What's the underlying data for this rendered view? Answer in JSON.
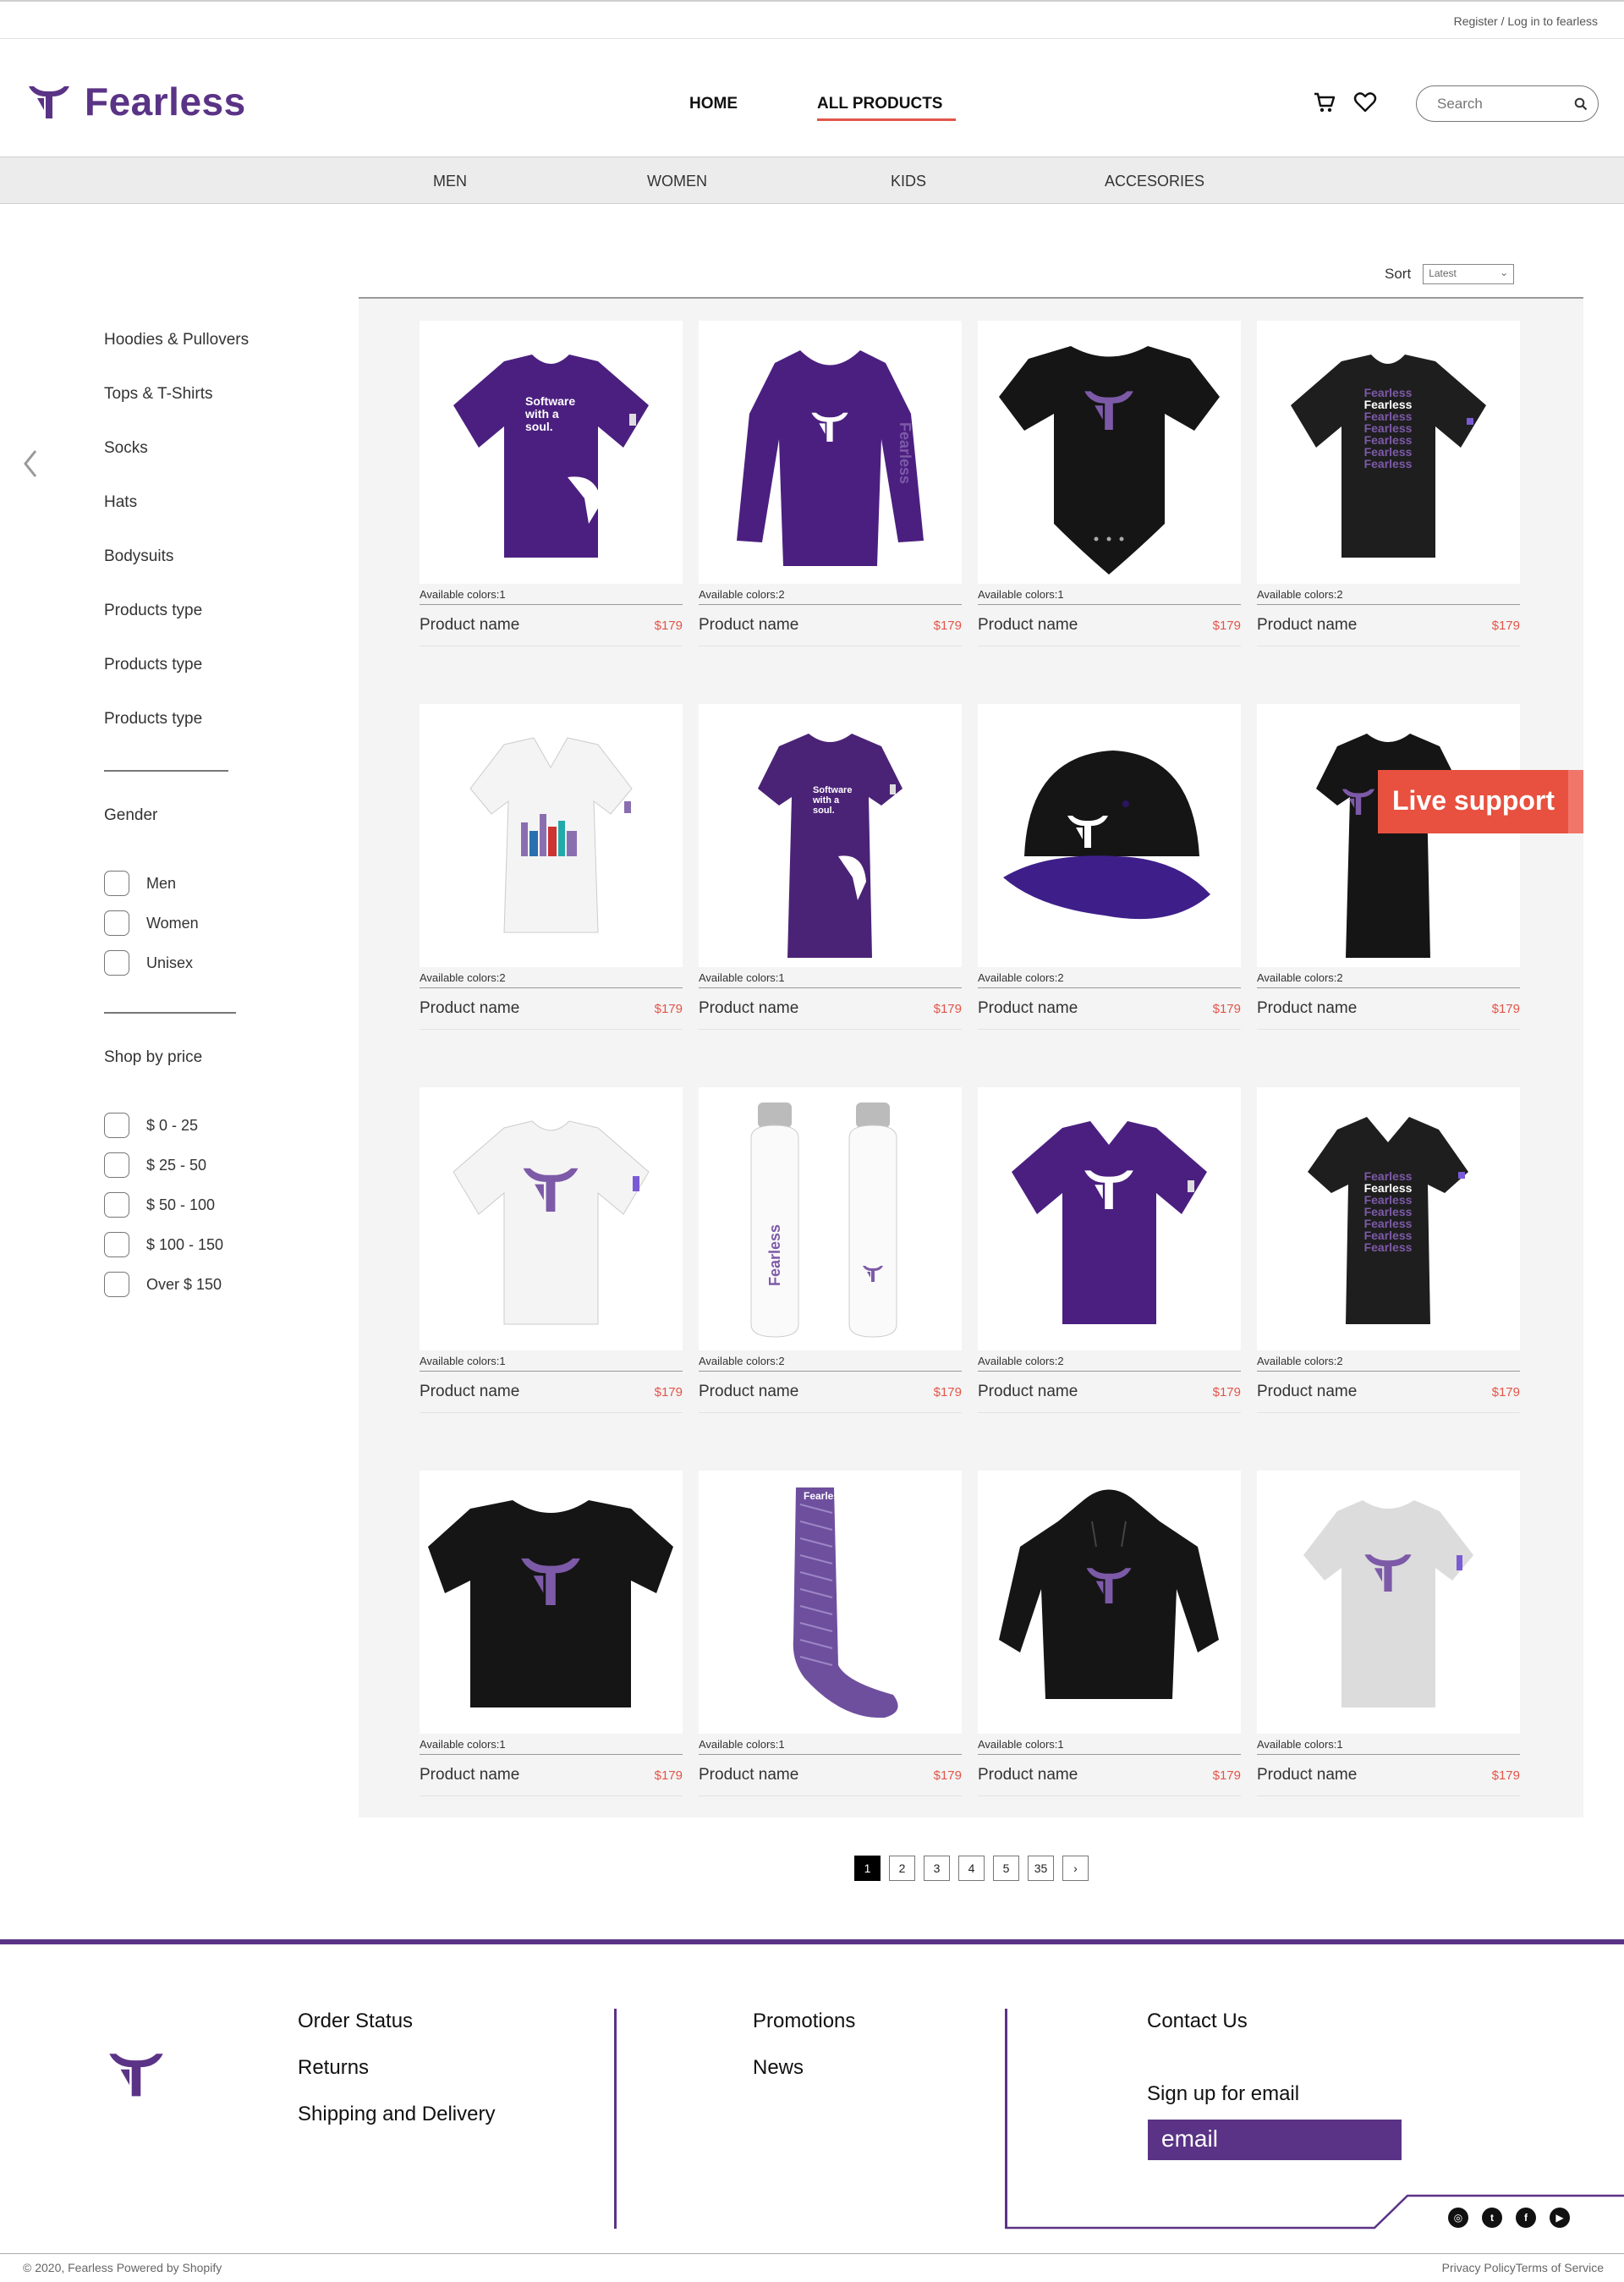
{
  "utility": {
    "register": "Register / Log in to fearless"
  },
  "brand": {
    "name": "Fearless",
    "color": "#5a3386",
    "accent": "#e2554a"
  },
  "nav": {
    "home": "HOME",
    "all_products": "ALL PRODUCTS"
  },
  "search": {
    "placeholder": "Search"
  },
  "categories": [
    "MEN",
    "WOMEN",
    "KIDS",
    "ACCESORIES"
  ],
  "sort": {
    "label": "Sort",
    "value": "Latest"
  },
  "sidebar": {
    "types": [
      "Hoodies & Pullovers",
      "Tops & T-Shirts",
      "Socks",
      "Hats",
      "Bodysuits",
      "Products type",
      "Products type",
      "Products type"
    ],
    "gender_heading": "Gender",
    "genders": [
      "Men",
      "Women",
      "Unisex"
    ],
    "price_heading": "Shop by price",
    "prices": [
      "$ 0 - 25",
      "$ 25 - 50",
      "$ 50 - 100",
      "$ 100 - 150",
      "Over $ 150"
    ]
  },
  "products": [
    {
      "name": "Product name",
      "price": "$179",
      "colors": "Available colors:1",
      "kind": "tee-purple-soul"
    },
    {
      "name": "Product name",
      "price": "$179",
      "colors": "Available colors:2",
      "kind": "longsleeve-purple"
    },
    {
      "name": "Product name",
      "price": "$179",
      "colors": "Available colors:1",
      "kind": "bodysuit-black"
    },
    {
      "name": "Product name",
      "price": "$179",
      "colors": "Available colors:2",
      "kind": "tee-black-fearless"
    },
    {
      "name": "Product name",
      "price": "$179",
      "colors": "Available colors:2",
      "kind": "vneck-white-city"
    },
    {
      "name": "Product name",
      "price": "$179",
      "colors": "Available colors:1",
      "kind": "fitted-purple-soul"
    },
    {
      "name": "Product name",
      "price": "$179",
      "colors": "Available colors:2",
      "kind": "cap-black"
    },
    {
      "name": "Product name",
      "price": "$179",
      "colors": "Available colors:2",
      "kind": "fitted-black"
    },
    {
      "name": "Product name",
      "price": "$179",
      "colors": "Available colors:1",
      "kind": "tee-white-logo"
    },
    {
      "name": "Product name",
      "price": "$179",
      "colors": "Available colors:2",
      "kind": "bottles-white"
    },
    {
      "name": "Product name",
      "price": "$179",
      "colors": "Available colors:2",
      "kind": "vneck-purple-logo"
    },
    {
      "name": "Product name",
      "price": "$179",
      "colors": "Available colors:2",
      "kind": "vneck-black-fearless"
    },
    {
      "name": "Product name",
      "price": "$179",
      "colors": "Available colors:1",
      "kind": "tee-black-logo"
    },
    {
      "name": "Product name",
      "price": "$179",
      "colors": "Available colors:1",
      "kind": "sock-purple"
    },
    {
      "name": "Product name",
      "price": "$179",
      "colors": "Available colors:1",
      "kind": "hoodie-black"
    },
    {
      "name": "Product name",
      "price": "$179",
      "colors": "Available colors:1",
      "kind": "tee-grey-logo"
    }
  ],
  "product_text": {
    "soul": [
      "Software",
      "with a",
      "soul."
    ],
    "fearless": "Fearless"
  },
  "live_support": "Live support",
  "pagination": [
    "1",
    "2",
    "3",
    "4",
    "5",
    "35",
    "›"
  ],
  "footer": {
    "col1": [
      "Order Status",
      "Returns",
      "Shipping and Delivery"
    ],
    "col2": [
      "Promotions",
      "News"
    ],
    "contact": "Contact Us",
    "signup": "Sign up for email",
    "email_placeholder": "email",
    "copyright": "© 2020, Fearless Powered by Shopify",
    "legal": "Privacy PolicyTerms of Service"
  }
}
